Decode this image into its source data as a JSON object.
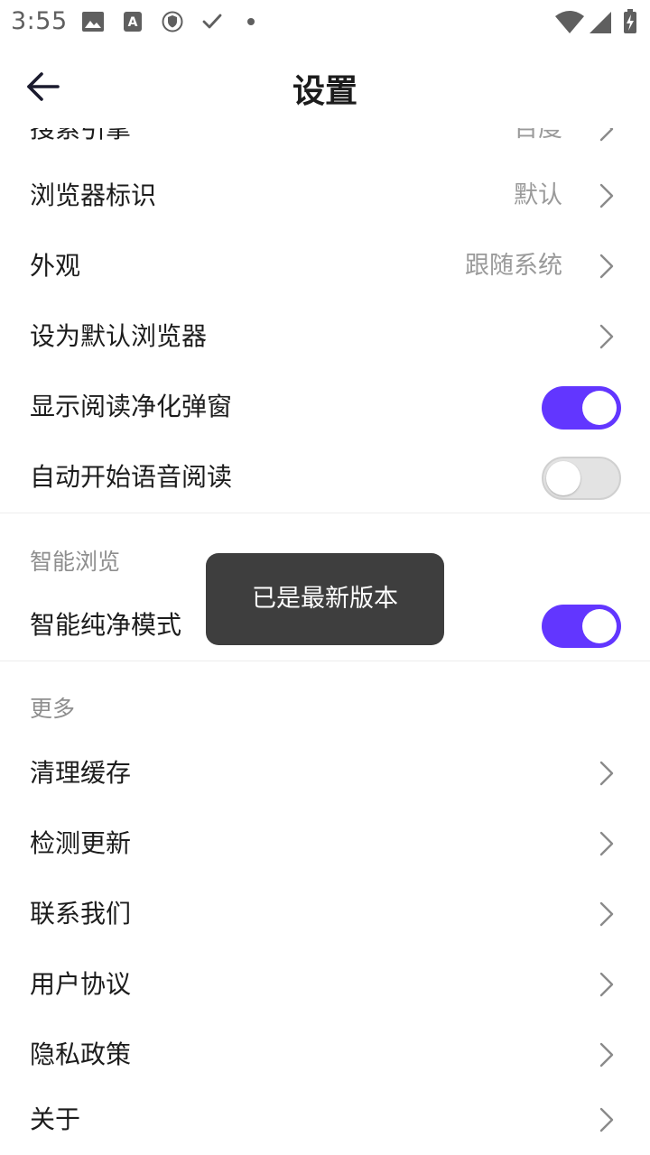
{
  "status_bar": {
    "time": "3:55",
    "icons": [
      "image-icon",
      "text-a-icon",
      "vpn-shield-icon",
      "check-icon",
      "dot-icon",
      "wifi-icon",
      "signal-icon",
      "battery-charging-icon"
    ]
  },
  "header": {
    "title": "设置",
    "back_icon": "arrow-left-icon"
  },
  "partial_row": {
    "label": "搜索引擎",
    "value": "百度"
  },
  "rows_general": [
    {
      "label": "浏览器标识",
      "value": "默认"
    },
    {
      "label": "外观",
      "value": "跟随系统"
    },
    {
      "label": "设为默认浏览器",
      "value": ""
    },
    {
      "label": "显示阅读净化弹窗",
      "toggle": true
    },
    {
      "label": "自动开始语音阅读",
      "toggle": false
    }
  ],
  "section_smart": {
    "title": "智能浏览",
    "rows": [
      {
        "label": "智能纯净模式",
        "toggle": true
      }
    ]
  },
  "section_more": {
    "title": "更多",
    "rows": [
      {
        "label": "清理缓存"
      },
      {
        "label": "检测更新"
      },
      {
        "label": "联系我们"
      },
      {
        "label": "用户协议"
      },
      {
        "label": "隐私政策"
      },
      {
        "label": "关于"
      }
    ]
  },
  "toast": {
    "message": "已是最新版本"
  },
  "colors": {
    "accent": "#6236ff",
    "toast_bg": "#3e3e3e",
    "secondary_text": "#9a9a9a"
  }
}
